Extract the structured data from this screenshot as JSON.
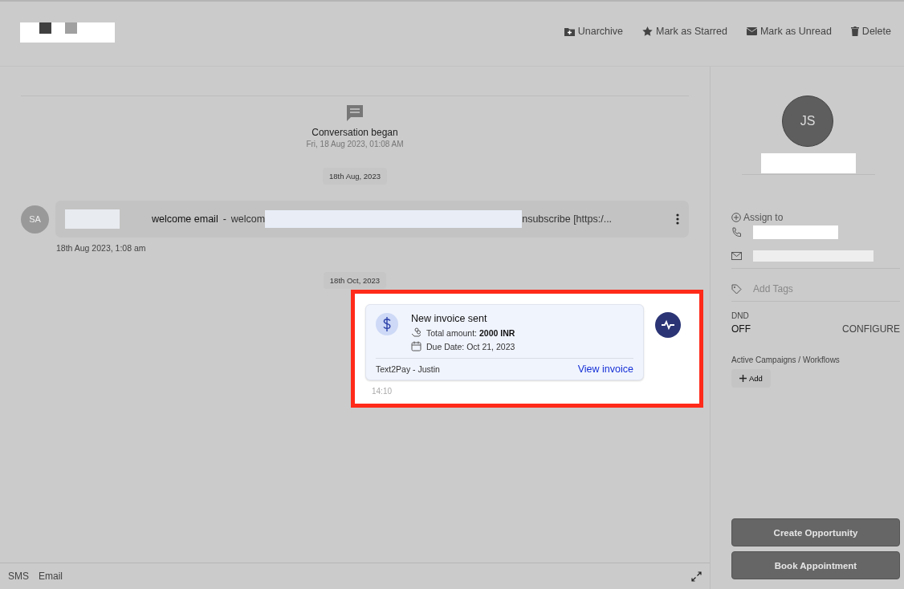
{
  "toolbar": {
    "actions": [
      {
        "kind": "unarchive",
        "label": "Unarchive"
      },
      {
        "kind": "star",
        "label": "Mark as Starred"
      },
      {
        "kind": "unread",
        "label": "Mark as Unread"
      },
      {
        "kind": "delete",
        "label": "Delete"
      }
    ]
  },
  "conversation": {
    "start_title": "Conversation began",
    "start_time": "Fri, 18 Aug 2023, 01:08 AM",
    "messages": [
      {
        "kind": "date",
        "label": "18th Aug, 2023"
      },
      {
        "kind": "email",
        "avatar": "SA",
        "subject": "welcome email",
        "separator": "-",
        "preview_start": "welcom",
        "preview_end": "nsubscribe [https:/...",
        "timestamp": "18th Aug 2023, 1:08 am"
      },
      {
        "kind": "date",
        "label": "18th Oct, 2023"
      },
      {
        "kind": "invoice",
        "title": "New invoice sent",
        "amount_label": "Total amount:",
        "amount": "2000 INR",
        "due": "Due Date: Oct 21, 2023",
        "source": "Text2Pay - Justin",
        "link": "View invoice",
        "time": "14:10"
      }
    ]
  },
  "composer": {
    "tabs": [
      {
        "label": "SMS",
        "selected": false
      },
      {
        "label": "Email",
        "selected": false
      }
    ]
  },
  "contact": {
    "initials": "JS",
    "assign": "Assign to",
    "tags_placeholder": "Add Tags",
    "dnd_label": "DND",
    "dnd_value": "OFF",
    "configure": "CONFIGURE",
    "campaigns_label": "Active Campaigns / Workflows",
    "add": "Add",
    "buttons": [
      "Create Opportunity",
      "Book Appointment"
    ]
  }
}
